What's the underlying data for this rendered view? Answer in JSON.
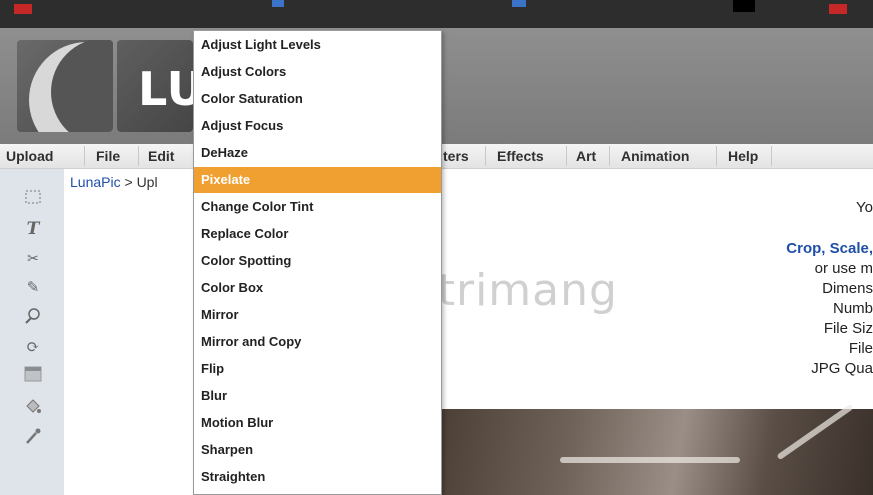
{
  "header": {
    "logo_text": "LU"
  },
  "menubar": {
    "items": [
      "Upload",
      "File",
      "Edit",
      "ters",
      "Effects",
      "Art",
      "Animation",
      "Help"
    ]
  },
  "breadcrumb": {
    "home": "LunaPic",
    "sep": " > ",
    "current": "Upl"
  },
  "dropdown": {
    "items": [
      "Adjust Light Levels",
      "Adjust Colors",
      "Color Saturation",
      "Adjust Focus",
      "DeHaze",
      "Pixelate",
      "Change Color Tint",
      "Replace Color",
      "Color Spotting",
      "Color Box",
      "Mirror",
      "Mirror and Copy",
      "Flip",
      "Blur",
      "Motion Blur",
      "Sharpen",
      "Straighten"
    ],
    "active_index": 5
  },
  "right_panel": {
    "line1": "Yo",
    "link": "Crop, Scale,",
    "line2": "or use m",
    "line3": "Dimens",
    "line4": "Numb",
    "line5": "File Siz",
    "line6": "File",
    "line7": "JPG Qua"
  },
  "watermark": {
    "text": "uantrimang"
  },
  "toolbar": {
    "icons": [
      "select-icon",
      "text-icon",
      "scissors-icon",
      "pencil-icon",
      "zoom-icon",
      "rotate-icon",
      "gradient-icon",
      "fill-bucket-icon",
      "eyedropper-icon"
    ]
  },
  "colors": {
    "accent": "#f0a030",
    "link": "#1f4fa8",
    "topbar": "#2d2d2d"
  }
}
